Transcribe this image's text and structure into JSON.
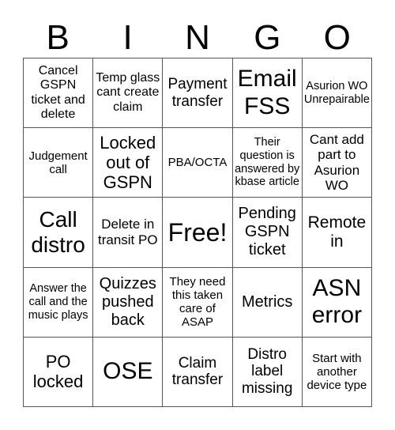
{
  "header": {
    "letters": [
      "B",
      "I",
      "N",
      "G",
      "O"
    ]
  },
  "grid": {
    "rows": [
      [
        "Cancel GSPN ticket and delete",
        "Temp glass cant create claim",
        "Payment transfer",
        "Email FSS",
        "Asurion WO Unrepairable"
      ],
      [
        "Judgement call",
        "Locked out of GSPN",
        "PBA/OCTA",
        "Their question is answered by kbase article",
        "Cant add part to Asurion WO"
      ],
      [
        "Call distro",
        "Delete in transit PO",
        "Free!",
        "Pending GSPN ticket",
        "Remote in"
      ],
      [
        "Answer the call and the music plays",
        "Quizzes pushed back",
        "They need this taken care of ASAP",
        "Metrics",
        "ASN error"
      ],
      [
        "PO locked",
        "OSE",
        "Claim transfer",
        "Distro label missing",
        "Start with another device type"
      ]
    ]
  }
}
